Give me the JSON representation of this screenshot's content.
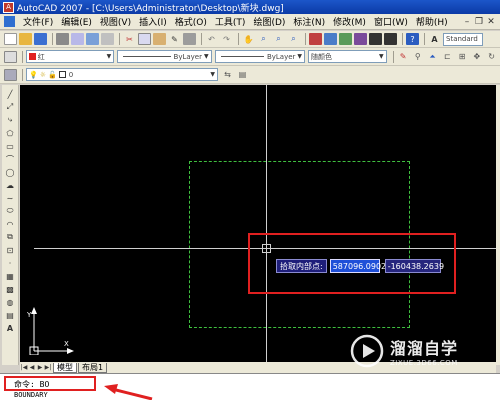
{
  "window": {
    "title": "AutoCAD 2007 - [C:\\Users\\Administrator\\Desktop\\新块.dwg]"
  },
  "menu": {
    "items": [
      "文件(F)",
      "编辑(E)",
      "视图(V)",
      "插入(I)",
      "格式(O)",
      "工具(T)",
      "绘图(D)",
      "标注(N)",
      "修改(M)",
      "窗口(W)",
      "帮助(H)"
    ]
  },
  "toolbar": {
    "text_style": "Standard",
    "color": "红",
    "linetype": "ByLayer",
    "lineweight": "ByLayer",
    "plot_style": "随颜色",
    "layer": "0"
  },
  "canvas": {
    "prompt_label": "拾取内部点:",
    "x_value": "587096.0902",
    "y_value": "-160438.2639",
    "ucs_y_label": "Y",
    "ucs_x_label": "X"
  },
  "tabs": {
    "items": [
      "模型",
      "布局1"
    ]
  },
  "command": {
    "line1": "命令: BO",
    "line2": "BOUNDARY"
  },
  "watermark": {
    "title": "溜溜自学",
    "subtitle": "ZIXUE.3D66.COM"
  },
  "colors": {
    "canvas_bg": "#000000",
    "highlight": "#e02020",
    "dashed_rect": "#3fbf3f",
    "title_bar": "#0b3aa6"
  }
}
